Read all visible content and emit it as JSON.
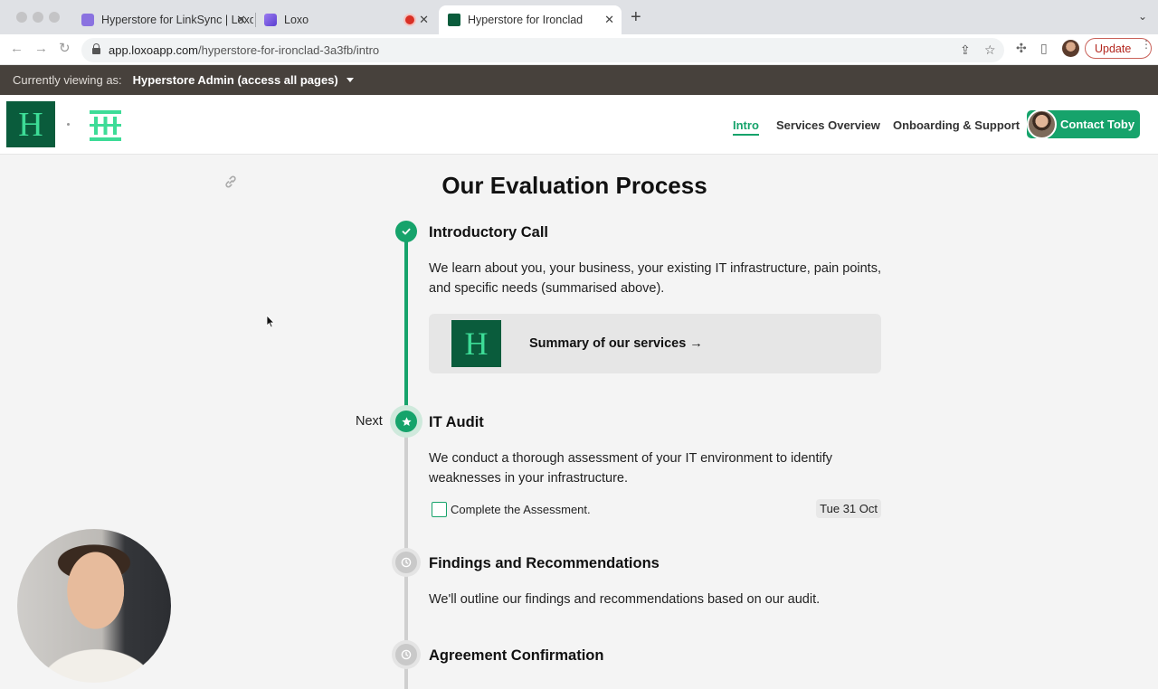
{
  "browser": {
    "tabs": [
      {
        "title": "Hyperstore for LinkSync | Loxo",
        "favicon_color": "#8a72e0",
        "active": false
      },
      {
        "title": "Loxo",
        "favicon_color": "#7a5ce0",
        "active": false
      },
      {
        "title": "Hyperstore for Ironclad",
        "favicon_color": "#0a5c3c",
        "active": true
      }
    ],
    "url_host": "app.loxoapp.com",
    "url_path": "/hyperstore-for-ironclad-3a3fb/intro",
    "update_label": "Update"
  },
  "admin_bar": {
    "prefix": "Currently viewing as:",
    "role": "Hyperstore Admin (access all pages)"
  },
  "header": {
    "logo_letter": "H",
    "nav": [
      "Intro",
      "Services Overview",
      "Onboarding & Support"
    ],
    "active_nav": "Intro",
    "contact_label": "Contact Toby",
    "accent_color": "#16a36b"
  },
  "main": {
    "title": "Our Evaluation Process",
    "next_label": "Next",
    "steps": [
      {
        "title": "Introductory Call",
        "status": "completed",
        "description": "We learn about you, your business, your existing IT infrastructure, pain points, and specific needs (summarised above).",
        "card": {
          "thumb_letter": "H",
          "label": "Summary of our services →"
        }
      },
      {
        "title": "IT Audit",
        "status": "current",
        "description": "We conduct a thorough assessment of your IT environment to identify weaknesses in your infrastructure.",
        "task": {
          "label": "Complete the Assessment.",
          "checked": false,
          "due": "Tue 31 Oct"
        }
      },
      {
        "title": "Findings and Recommendations",
        "status": "pending",
        "description": "We'll outline our findings and recommendations based on our audit."
      },
      {
        "title": "Agreement Confirmation",
        "status": "pending"
      }
    ]
  }
}
